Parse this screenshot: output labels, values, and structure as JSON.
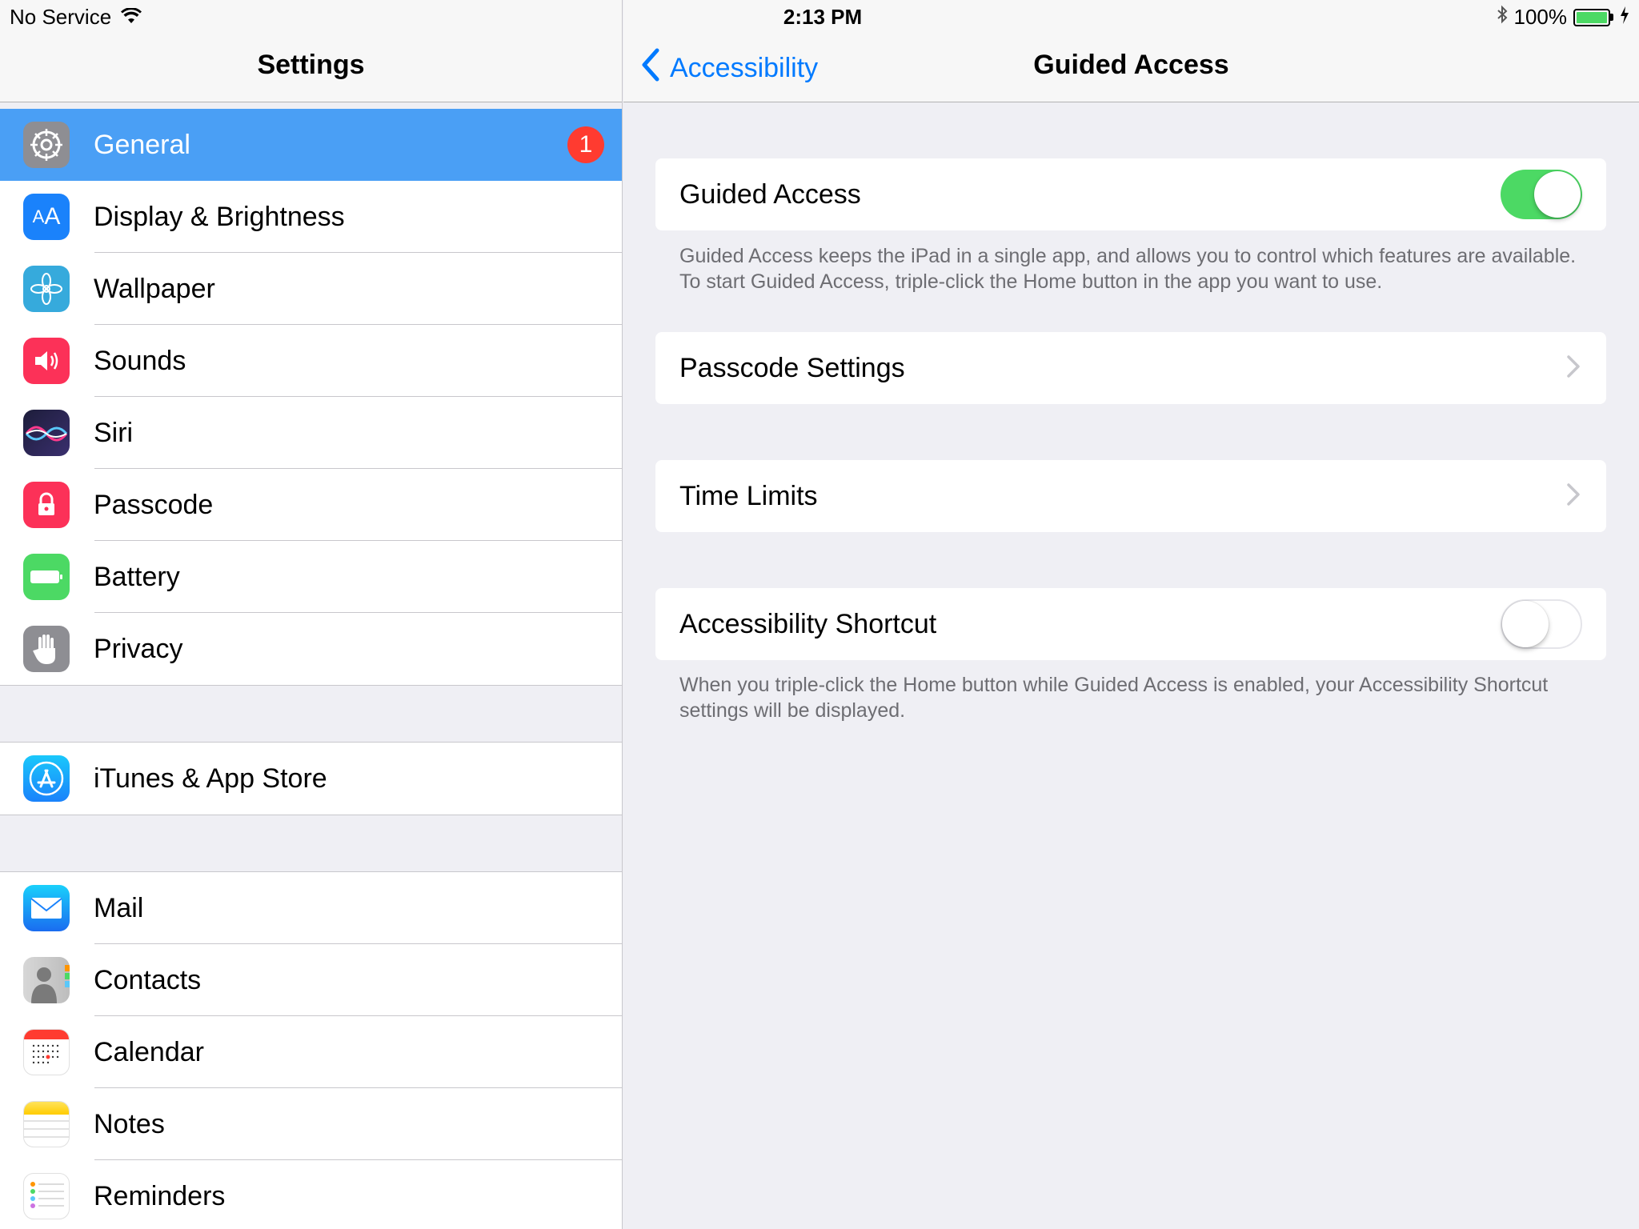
{
  "status": {
    "carrier": "No Service",
    "time": "2:13 PM",
    "battery": "100%"
  },
  "sidebar": {
    "title": "Settings",
    "groups": [
      [
        {
          "label": "General",
          "icon": "gear-icon",
          "color": "#8e8e93",
          "badge": "1",
          "selected": true
        },
        {
          "label": "Display & Brightness",
          "icon": "text-size-icon",
          "color": "#1a82fb"
        },
        {
          "label": "Wallpaper",
          "icon": "flower-icon",
          "color": "#36aadc"
        },
        {
          "label": "Sounds",
          "icon": "speaker-icon",
          "color": "#fc3158"
        },
        {
          "label": "Siri",
          "icon": "siri-icon",
          "color": "#1d1d3a"
        },
        {
          "label": "Passcode",
          "icon": "lock-icon",
          "color": "#fc3158"
        },
        {
          "label": "Battery",
          "icon": "battery-icon",
          "color": "#4cd964"
        },
        {
          "label": "Privacy",
          "icon": "hand-icon",
          "color": "#8e8e93"
        }
      ],
      [
        {
          "label": "iTunes & App Store",
          "icon": "app-store-icon",
          "color": "#1a8cf0"
        }
      ],
      [
        {
          "label": "Mail",
          "icon": "envelope-icon",
          "color": "#1e90ff"
        },
        {
          "label": "Contacts",
          "icon": "contacts-icon",
          "color": "#b7b7b7"
        },
        {
          "label": "Calendar",
          "icon": "calendar-icon",
          "color": "#ffffff"
        },
        {
          "label": "Notes",
          "icon": "notes-icon",
          "color": "#ffd83b"
        },
        {
          "label": "Reminders",
          "icon": "reminders-icon",
          "color": "#ffffff"
        }
      ]
    ]
  },
  "detail": {
    "back_label": "Accessibility",
    "title": "Guided Access",
    "guided_access": {
      "label": "Guided Access",
      "on": true
    },
    "guided_access_footer": "Guided Access keeps the iPad in a single app, and allows you to control which features are available. To start Guided Access, triple-click the Home button in the app you want to use.",
    "passcode_settings": "Passcode Settings",
    "time_limits": "Time Limits",
    "accessibility_shortcut": {
      "label": "Accessibility Shortcut",
      "on": false
    },
    "accessibility_shortcut_footer": "When you triple-click the Home button while Guided Access is enabled, your Accessibility Shortcut settings will be displayed."
  }
}
